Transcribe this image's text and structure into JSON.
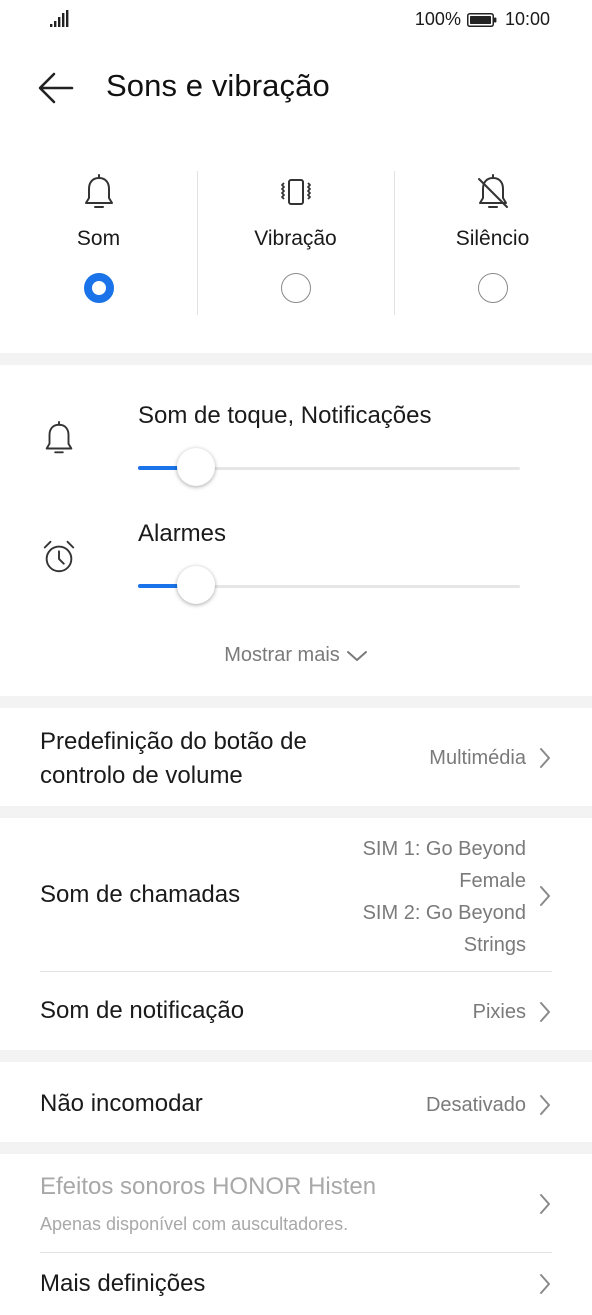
{
  "status_bar": {
    "battery": "100%",
    "time": "10:00"
  },
  "header": {
    "title": "Sons e vibração"
  },
  "modes": [
    {
      "label": "Som",
      "icon": "bell-icon",
      "selected": true
    },
    {
      "label": "Vibração",
      "icon": "vibration-icon",
      "selected": false
    },
    {
      "label": "Silêncio",
      "icon": "bell-off-icon",
      "selected": false
    }
  ],
  "volumes": [
    {
      "label": "Som de toque, Notificações",
      "icon": "bell-icon",
      "level": 0.12
    },
    {
      "label": "Alarmes",
      "icon": "alarm-clock-icon",
      "level": 0.12
    }
  ],
  "show_more": {
    "label": "Mostrar mais"
  },
  "settings": {
    "volume_button": {
      "title_line1": "Predefinição do botão de",
      "title_line2": "controlo de volume",
      "value": "Multimédia"
    },
    "ringtone": {
      "title": "Som de chamadas",
      "value_lines": [
        "SIM 1: Go Beyond",
        "Female",
        "SIM 2: Go Beyond",
        "Strings"
      ]
    },
    "notification_sound": {
      "title": "Som de notificação",
      "value": "Pixies"
    },
    "do_not_disturb": {
      "title": "Não incomodar",
      "value": "Desativado"
    },
    "histen": {
      "title": "Efeitos sonoros HONOR Histen",
      "subtitle": "Apenas disponível com auscultadores."
    },
    "more_settings": {
      "title": "Mais definições"
    }
  },
  "colors": {
    "accent": "#1a73e8",
    "secondary_text": "#7a7a7a",
    "disabled_text": "#a8a8a8",
    "divider": "#e2e2e2"
  }
}
